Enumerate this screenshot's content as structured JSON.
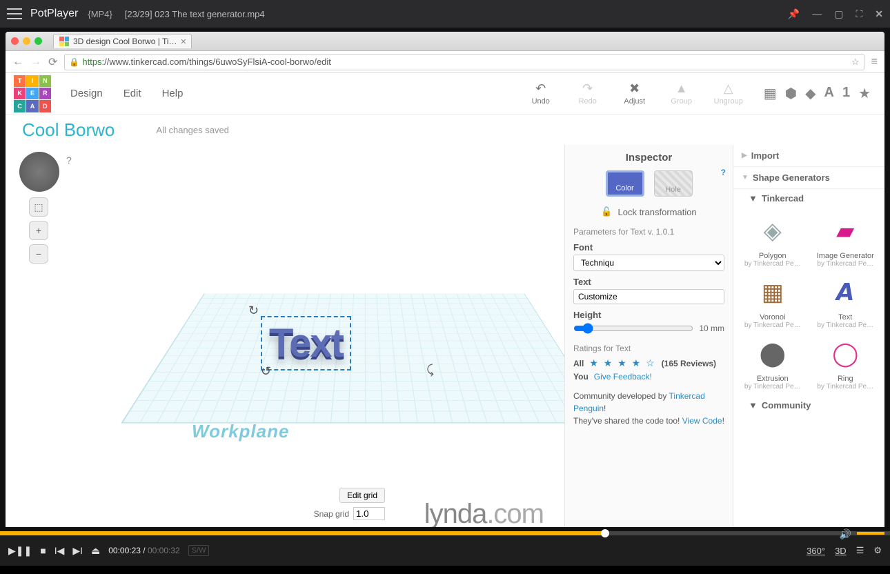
{
  "player": {
    "app_name": "PotPlayer",
    "codec": "{MP4}",
    "title": "[23/29] 023 The text generator.mp4",
    "time_current": "00:00:23",
    "time_total": "00:00:32",
    "sw": "S/W",
    "r360": "360°",
    "r3d": "3D"
  },
  "browser": {
    "tab_title": "3D design Cool Borwo | Ti…",
    "url_proto": "https",
    "url_rest": "://www.tinkercad.com/things/6uwoSyFlsiA-cool-borwo/edit"
  },
  "logo_letters": [
    "T",
    "I",
    "N",
    "K",
    "E",
    "R",
    "C",
    "A",
    "D"
  ],
  "menu": {
    "design": "Design",
    "edit": "Edit",
    "help": "Help"
  },
  "tools": {
    "undo": "Undo",
    "redo": "Redo",
    "adjust": "Adjust",
    "group": "Group",
    "ungroup": "Ungroup"
  },
  "project": {
    "name": "Cool Borwo",
    "status": "All changes saved"
  },
  "canvas": {
    "workplane": "Workplane",
    "text3d": "Text",
    "question": "?"
  },
  "grid": {
    "edit": "Edit grid",
    "snap_label": "Snap grid",
    "snap_value": "1.0"
  },
  "inspector": {
    "title": "Inspector",
    "color": "Color",
    "hole": "Hole",
    "lock": "Lock transformation",
    "params_header": "Parameters for Text v. 1.0.1",
    "font_label": "Font",
    "font_value": "Techniqu",
    "text_label": "Text",
    "text_value": "Customize",
    "height_label": "Height",
    "height_value": "10 mm",
    "ratings_header": "Ratings for Text",
    "all": "All",
    "review_count": "(165 Reviews)",
    "you": "You",
    "give_feedback": "Give Feedback!",
    "community_prefix": "Community developed by ",
    "community_link": "Tinkercad Penguin",
    "community_suffix": "!",
    "shared_prefix": "They've shared the code too! ",
    "view_code": "View Code",
    "shared_suffix": "!"
  },
  "right": {
    "import": "Import",
    "shape_gen": "Shape Generators",
    "tinkercad": "Tinkercad",
    "community": "Community",
    "shapes": [
      {
        "name": "Polygon",
        "by": "by Tinkercad Pe…",
        "glyph": "◈",
        "color": "#9aa"
      },
      {
        "name": "Image Generator",
        "by": "by Tinkercad Pe…",
        "glyph": "▰",
        "color": "#d81b8c"
      },
      {
        "name": "Voronoi",
        "by": "by Tinkercad Pe…",
        "glyph": "▦",
        "color": "#9e6b3a"
      },
      {
        "name": "Text",
        "by": "by Tinkercad Pe…",
        "glyph": "𝘼",
        "color": "#4a5bb8"
      },
      {
        "name": "Extrusion",
        "by": "by Tinkercad Pe…",
        "glyph": "⬤",
        "color": "#666"
      },
      {
        "name": "Ring",
        "by": "by Tinkercad Pe…",
        "glyph": "◯",
        "color": "#e0318c"
      }
    ]
  },
  "lynda": {
    "brand": "lynda",
    "suffix": ".com"
  }
}
